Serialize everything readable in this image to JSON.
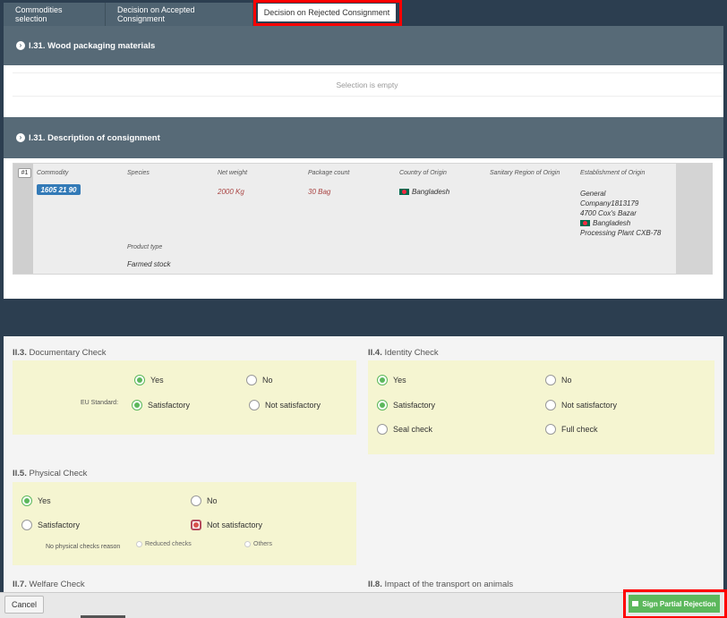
{
  "tabs": [
    {
      "label": "Commodities selection"
    },
    {
      "label": "Decision on Accepted Consignment"
    },
    {
      "label": "Decision on Rejected Consignment"
    }
  ],
  "wood": {
    "title": "I.31. Wood packaging materials",
    "empty_text": "Selection is empty"
  },
  "consignment": {
    "title": "I.31. Description of consignment",
    "row_number": "#1",
    "headers": {
      "commodity": "Commodity",
      "species": "Species",
      "net_weight": "Net weight",
      "package_count": "Package count",
      "country": "Country of Origin",
      "sanitary": "Sanitary Region of Origin",
      "establishment": "Establishment of Origin",
      "product_type": "Product type"
    },
    "commodity_code": "1605 21 90",
    "net_weight": "2000 Kg",
    "package_count": "30 Bag",
    "country": "Bangladesh",
    "establishment": {
      "line1": "General",
      "line2": "Company1813179",
      "line3": "4700 Cox's Bazar",
      "country": "Bangladesh",
      "line5": "Processing Plant CXB-78"
    },
    "product_type": "Farmed stock"
  },
  "documentary": {
    "num": "II.3.",
    "title": "Documentary Check",
    "yes": "Yes",
    "no": "No",
    "eu_label": "EU Standard:",
    "satisfactory": "Satisfactory",
    "not_satisfactory": "Not satisfactory"
  },
  "identity": {
    "num": "II.4.",
    "title": "Identity Check",
    "yes": "Yes",
    "no": "No",
    "satisfactory": "Satisfactory",
    "not_satisfactory": "Not satisfactory",
    "seal": "Seal check",
    "full": "Full check"
  },
  "physical": {
    "num": "II.5.",
    "title": "Physical Check",
    "yes": "Yes",
    "no": "No",
    "satisfactory": "Satisfactory",
    "not_satisfactory": "Not satisfactory",
    "reason_label": "No physical checks reason",
    "reduced": "Reduced checks",
    "others": "Others"
  },
  "welfare": {
    "num": "II.7.",
    "title": "Welfare Check"
  },
  "transport": {
    "num": "II.8.",
    "title": "Impact of the transport on animals"
  },
  "footer": {
    "cancel": "Cancel",
    "sign": "Sign Partial Rejection"
  }
}
